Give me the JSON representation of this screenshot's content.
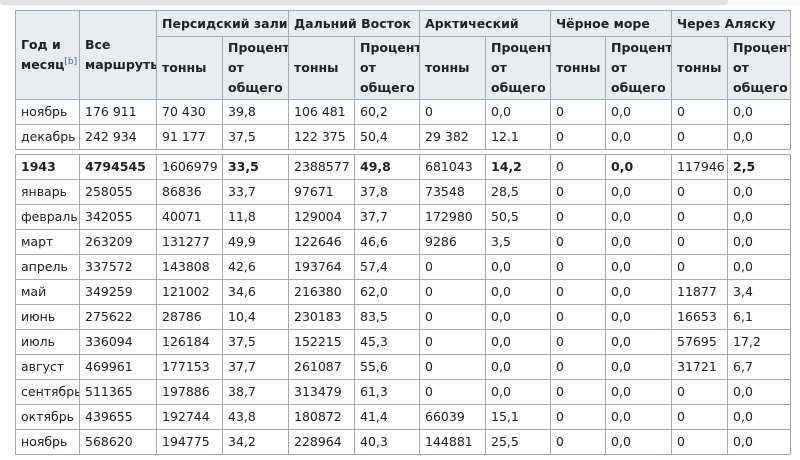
{
  "header": {
    "year_month": "Год и месяц",
    "note": "[b]",
    "all_routes": "Все маршруты",
    "routes": [
      "Персидский залив",
      "Дальний Восток",
      "Арктический",
      "Чёрное море",
      "Через Аляску"
    ],
    "sub_tonnes": "тонны",
    "sub_percent": "Процент от общего"
  },
  "rows_before": [
    {
      "label": "ноябрь",
      "cells": [
        "176 911",
        "70 430",
        "39,8",
        "106 481",
        "60,2",
        "0",
        "0,0",
        "0",
        "0,0",
        "0",
        "0,0"
      ]
    },
    {
      "label": "декабрь",
      "cells": [
        "242 934",
        "91 177",
        "37,5",
        "122 375",
        "50,4",
        "29 382",
        "12.1",
        "0",
        "0,0",
        "0",
        "0,0"
      ]
    }
  ],
  "year_row": {
    "label": "1943",
    "cells": [
      "4794545",
      "1606979",
      "33,5",
      "2388577",
      "49,8",
      "681043",
      "14,2",
      "0",
      "0,0",
      "117946",
      "2,5"
    ]
  },
  "rows": [
    {
      "label": "январь",
      "cells": [
        "258055",
        "86836",
        "33,7",
        "97671",
        "37,8",
        "73548",
        "28,5",
        "0",
        "0,0",
        "0",
        "0,0"
      ]
    },
    {
      "label": "февраль",
      "cells": [
        "342055",
        "40071",
        "11,8",
        "129004",
        "37,7",
        "172980",
        "50,5",
        "0",
        "0,0",
        "0",
        "0,0"
      ]
    },
    {
      "label": "март",
      "cells": [
        "263209",
        "131277",
        "49,9",
        "122646",
        "46,6",
        "9286",
        "3,5",
        "0",
        "0,0",
        "0",
        "0,0"
      ]
    },
    {
      "label": "апрель",
      "cells": [
        "337572",
        "143808",
        "42,6",
        "193764",
        "57,4",
        "0",
        "0,0",
        "0",
        "0,0",
        "0",
        "0,0"
      ]
    },
    {
      "label": "май",
      "cells": [
        "349259",
        "121002",
        "34,6",
        "216380",
        "62,0",
        "0",
        "0,0",
        "0",
        "0,0",
        "11877",
        "3,4"
      ]
    },
    {
      "label": "июнь",
      "cells": [
        "275622",
        "28786",
        "10,4",
        "230183",
        "83,5",
        "0",
        "0,0",
        "0",
        "0,0",
        "16653",
        "6,1"
      ]
    },
    {
      "label": "июль",
      "cells": [
        "336094",
        "126184",
        "37,5",
        "152215",
        "45,3",
        "0",
        "0,0",
        "0",
        "0,0",
        "57695",
        "17,2"
      ]
    },
    {
      "label": "август",
      "cells": [
        "469961",
        "177153",
        "37,7",
        "261087",
        "55,6",
        "0",
        "0,0",
        "0",
        "0,0",
        "31721",
        "6,7"
      ]
    },
    {
      "label": "сентябрь",
      "cells": [
        "511365",
        "197886",
        "38,7",
        "313479",
        "61,3",
        "0",
        "0,0",
        "0",
        "0,0",
        "0",
        "0,0"
      ]
    },
    {
      "label": "октябрь",
      "cells": [
        "439655",
        "192744",
        "43,8",
        "180872",
        "41,4",
        "66039",
        "15,1",
        "0",
        "0,0",
        "0",
        "0,0"
      ]
    },
    {
      "label": "ноябрь",
      "cells": [
        "568620",
        "194775",
        "34,2",
        "228964",
        "40,3",
        "144881",
        "25,5",
        "0",
        "0,0",
        "0",
        "0,0"
      ]
    }
  ]
}
